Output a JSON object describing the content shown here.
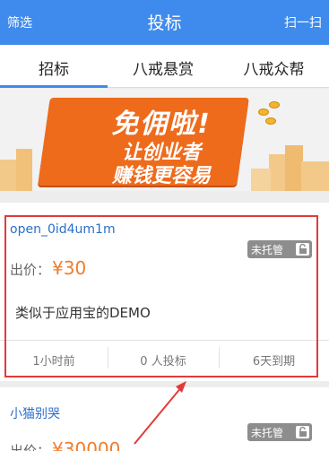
{
  "topbar": {
    "left": "筛选",
    "title": "投标",
    "right": "扫一扫",
    "bg": "#3f8bed"
  },
  "tabs": [
    {
      "label": "招标",
      "active": true
    },
    {
      "label": "八戒悬赏",
      "active": false
    },
    {
      "label": "八戒众帮",
      "active": false
    }
  ],
  "banner": {
    "line1": "免佣啦!",
    "line2": "让创业者",
    "line3": "赚钱更容易"
  },
  "listings": [
    {
      "user": "open_0id4um1m",
      "badge": "未托管",
      "price_label": "出价：",
      "price": "¥30",
      "desc": "类似于应用宝的DEMO",
      "time": "1小时前",
      "bids": "0 人投标",
      "expiry": "6天到期"
    },
    {
      "user": "小猫别哭",
      "badge": "未托管",
      "price_label": "出价：",
      "price": "¥30000"
    }
  ],
  "colors": {
    "accent": "#3f8bed",
    "price": "#f07c2a",
    "highlight": "#e23a3a",
    "banner": "#ee6b1c"
  }
}
